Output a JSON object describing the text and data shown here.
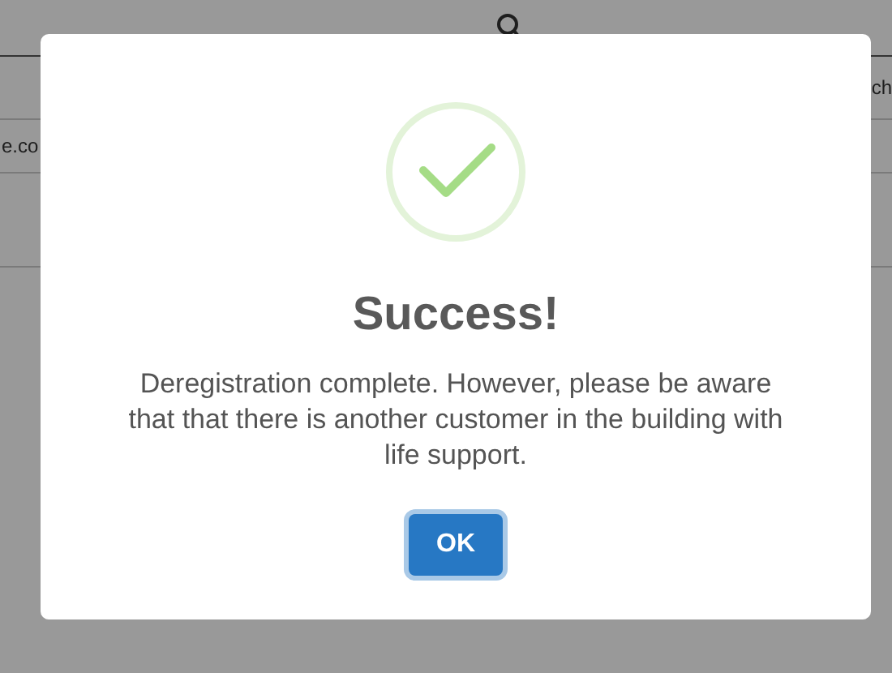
{
  "background": {
    "row_1_text": "ch",
    "row_2_text": "e.co"
  },
  "dialog": {
    "title": "Success!",
    "message": "Deregistration complete. However, please be aware that that there is another customer in the building with life support.",
    "button": "OK"
  }
}
